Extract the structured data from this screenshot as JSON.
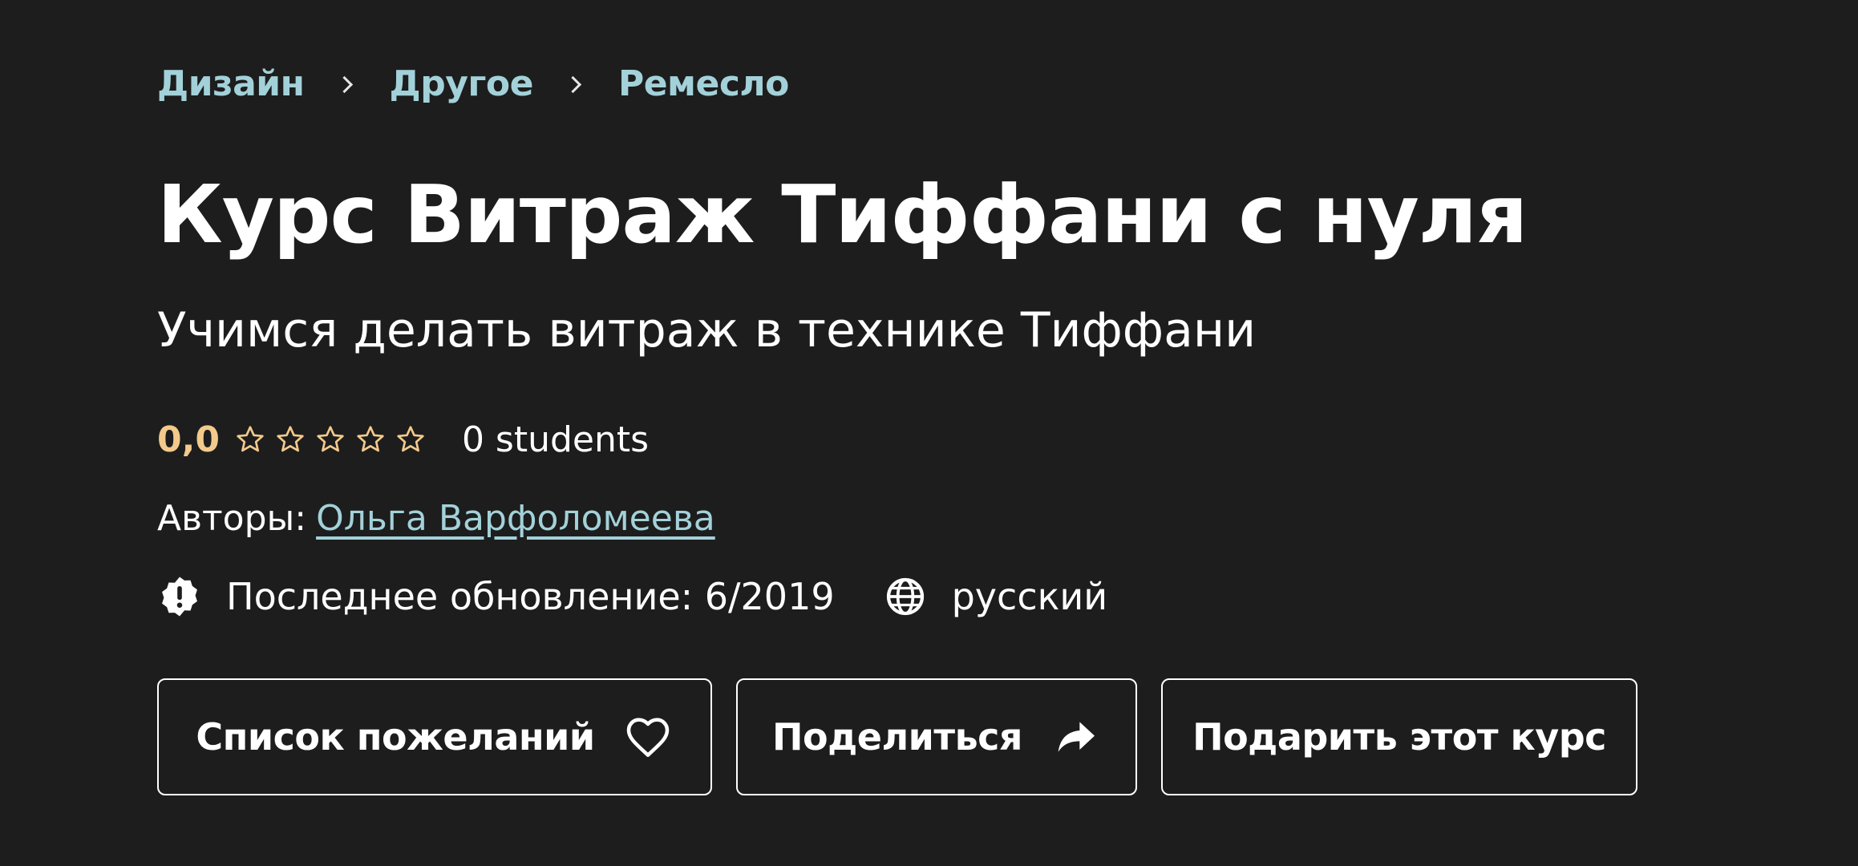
{
  "breadcrumb": {
    "items": [
      "Дизайн",
      "Другое",
      "Ремесло"
    ]
  },
  "course": {
    "title": "Курс Витраж Тиффани с нуля",
    "subtitle": "Учимся делать витраж в технике Тиффани",
    "rating": "0,0",
    "rating_stars_filled": 0,
    "rating_stars_total": 5,
    "students": "0 students",
    "authors_label": "Авторы:",
    "author": "Ольга Варфоломеева",
    "last_updated": "Последнее обновление: 6/2019",
    "language": "русский"
  },
  "actions": {
    "wishlist": "Список пожеланий",
    "share": "Поделиться",
    "gift": "Подарить этот курс"
  },
  "icons": {
    "breadcrumb_separator": "chevron-right-icon",
    "rating_star": "star-outline-icon",
    "last_updated": "alert-badge-icon",
    "language": "globe-icon",
    "wishlist": "heart-icon",
    "share": "share-arrow-icon"
  },
  "colors": {
    "background": "#1d1d1d",
    "link": "#a3d1d9",
    "rating": "#f3ca8c",
    "text": "#ffffff"
  }
}
